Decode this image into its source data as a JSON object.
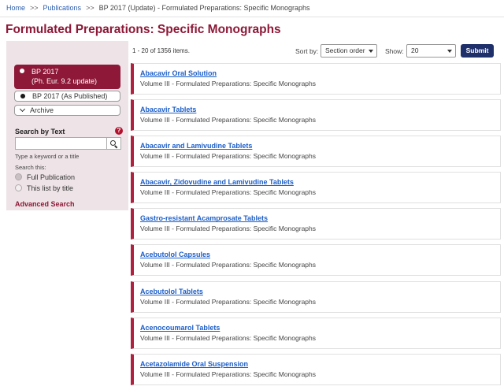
{
  "breadcrumb": {
    "home": "Home",
    "sep": ">>",
    "publications": "Publications",
    "current": "BP 2017 (Update) - Formulated Preparations: Specific Monographs"
  },
  "page_title": "Formulated Preparations: Specific Monographs",
  "sidebar": {
    "edition_active_line1": "BP 2017",
    "edition_active_line2": "(Ph. Eur. 9.2 update)",
    "edition_published": "BP 2017 (As Published)",
    "archive": "Archive",
    "search_title": "Search by Text",
    "help_icon": "?",
    "search_placeholder": "",
    "search_hint": "Type a keyword or a title",
    "search_scope_label": "Search this:",
    "scope_options": [
      "Full Publication",
      "This list by title"
    ],
    "scope_selected": "Full Publication",
    "advanced_search": "Advanced Search"
  },
  "toolbar": {
    "items_count": "1 - 20 of 1356 items.",
    "sort_label": "Sort by:",
    "sort_value": "Section order",
    "show_label": "Show:",
    "show_value": "20",
    "submit": "Submit"
  },
  "results": [
    {
      "title": "Abacavir Oral Solution",
      "subtitle": "Volume III - Formulated Preparations: Specific Monographs"
    },
    {
      "title": "Abacavir Tablets",
      "subtitle": "Volume III - Formulated Preparations: Specific Monographs"
    },
    {
      "title": "Abacavir and Lamivudine Tablets",
      "subtitle": "Volume III - Formulated Preparations: Specific Monographs"
    },
    {
      "title": "Abacavir, Zidovudine and Lamivudine Tablets",
      "subtitle": "Volume III - Formulated Preparations: Specific Monographs"
    },
    {
      "title": "Gastro-resistant Acamprosate Tablets",
      "subtitle": "Volume III - Formulated Preparations: Specific Monographs"
    },
    {
      "title": "Acebutolol Capsules",
      "subtitle": "Volume III - Formulated Preparations: Specific Monographs"
    },
    {
      "title": "Acebutolol Tablets",
      "subtitle": "Volume III - Formulated Preparations: Specific Monographs"
    },
    {
      "title": "Acenocoumarol Tablets",
      "subtitle": "Volume III - Formulated Preparations: Specific Monographs"
    },
    {
      "title": "Acetazolamide Oral Suspension",
      "subtitle": "Volume III - Formulated Preparations: Specific Monographs"
    }
  ],
  "colors": {
    "brand": "#8d1837",
    "card_accent": "#b0213f",
    "link": "#1c5ec8",
    "submit": "#1e2f6a"
  }
}
